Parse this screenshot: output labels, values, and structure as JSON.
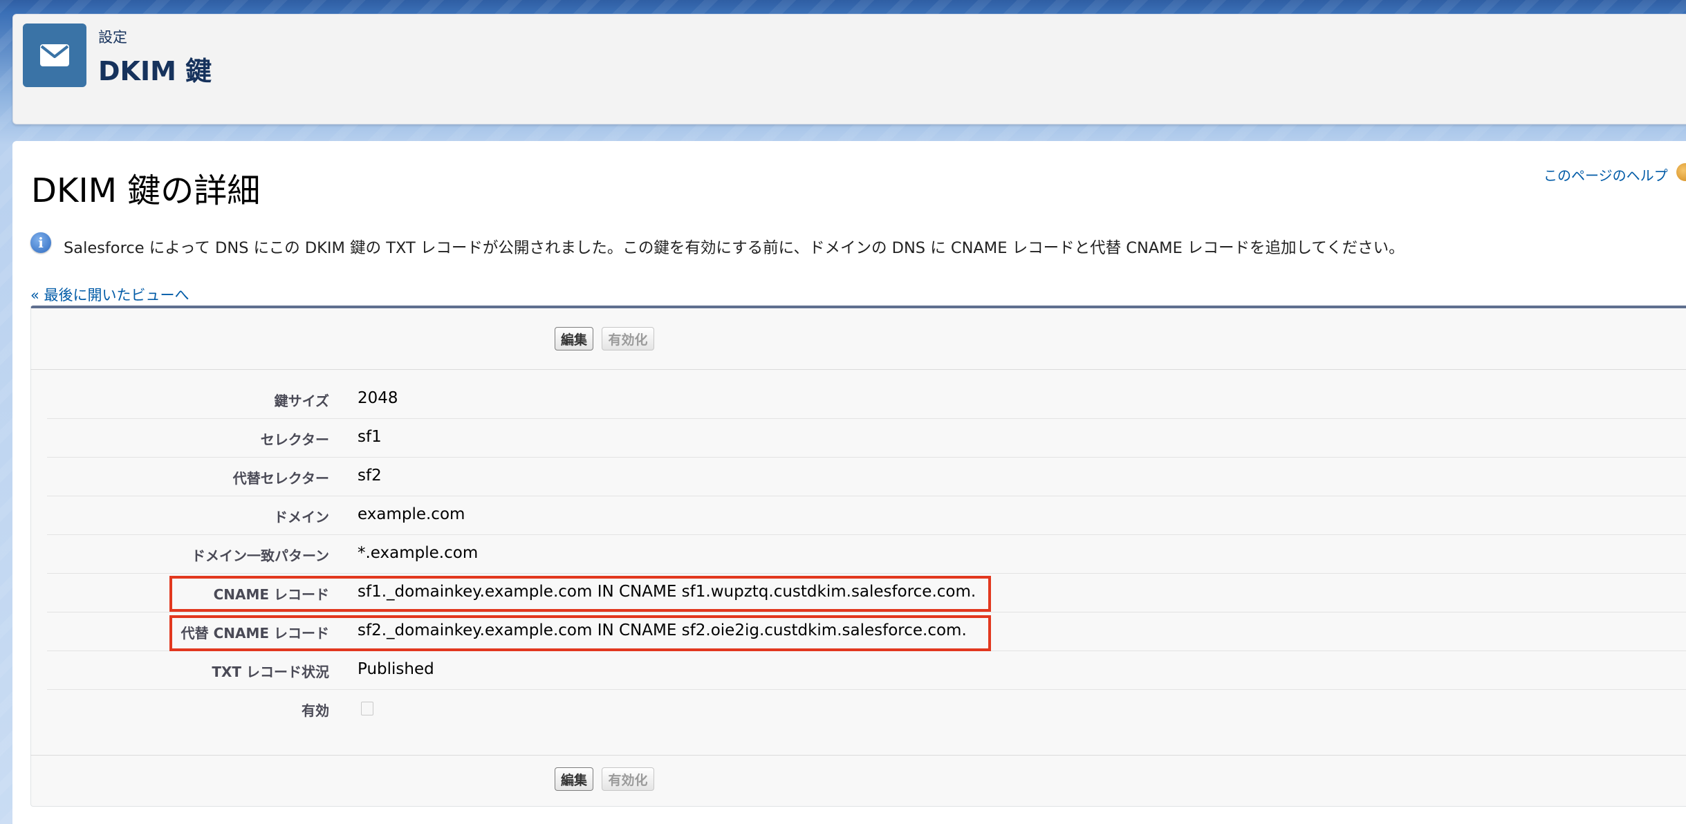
{
  "header": {
    "breadcrumb": "設定",
    "title": "DKIM 鍵",
    "icon": "email-icon"
  },
  "page": {
    "title": "DKIM 鍵の詳細",
    "help_link": "このページのヘルプ",
    "info_message": "Salesforce によって DNS にこの DKIM 鍵の TXT レコードが公開されました。この鍵を有効にする前に、ドメインの DNS に CNAME レコードと代替 CNAME レコードを追加してください。",
    "back_link": "« 最後に開いたビューへ"
  },
  "buttons": {
    "edit": "編集",
    "activate": "有効化"
  },
  "fields": [
    {
      "label": "鍵サイズ",
      "value": "2048"
    },
    {
      "label": "セレクター",
      "value": "sf1"
    },
    {
      "label": "代替セレクター",
      "value": "sf2"
    },
    {
      "label": "ドメイン",
      "value": "example.com"
    },
    {
      "label": "ドメイン一致パターン",
      "value": "*.example.com"
    },
    {
      "label": "CNAME レコード",
      "value": "sf1._domainkey.example.com IN CNAME sf1.wupztq.custdkim.salesforce.com."
    },
    {
      "label": "代替 CNAME レコード",
      "value": "sf2._domainkey.example.com IN CNAME sf2.oie2ig.custdkim.salesforce.com."
    },
    {
      "label": "TXT レコード状況",
      "value": "Published"
    },
    {
      "label": "有効",
      "value": ""
    }
  ],
  "colors": {
    "accent": "#3a73a6",
    "link": "#015ba7",
    "highlight": "#e2381f",
    "panel_border": "#5f6f8f"
  }
}
